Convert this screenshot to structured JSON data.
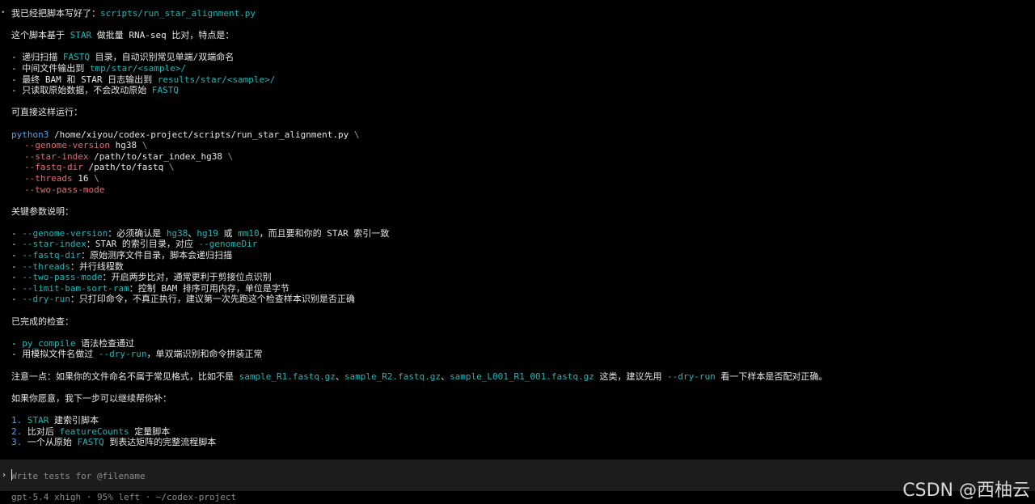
{
  "message": {
    "intro": "我已经把脚本写好了：",
    "script_path": "scripts/run_star_alignment.py",
    "summary_a": "这个脚本基于 ",
    "summary_star": "STAR",
    "summary_b": " 做批量 RNA-seq 比对，特点是：",
    "features": {
      "f1_a": "- 递归扫描 ",
      "f1_code": "FASTQ",
      "f1_b": " 目录，自动识别常见单端/双端命名",
      "f2_a": "- 中间文件输出到 ",
      "f2_code": "tmp/star/<sample>/",
      "f3_a": "- 最终 BAM 和 STAR 日志输出到 ",
      "f3_code": "results/star/<sample>/",
      "f4_a": "- 只读取原始数据，不会改动原始 ",
      "f4_code": "FASTQ"
    },
    "run_heading": "可直接这样运行：",
    "command": {
      "exe": "python3",
      "path": " /home/xiyou/codex-project/scripts/run_star_alignment.py ",
      "cont": "\\",
      "genome_flag": "--genome-version",
      "genome_val": " hg38 ",
      "index_flag": "--star-index",
      "index_val": " /path/to/star_index_hg38 ",
      "fastq_flag": "--fastq-dir",
      "fastq_val": " /path/to/fastq ",
      "threads_flag": "--threads",
      "threads_val": " 16 ",
      "twopass_flag": "--two-pass-mode"
    },
    "params_heading": "关键参数说明：",
    "params": {
      "p1_flag": "--genome-version",
      "p1_a": "：必须确认是 ",
      "p1_c1": "hg38",
      "p1_sep1": "、",
      "p1_c2": "hg19",
      "p1_or": " 或 ",
      "p1_c3": "mm10",
      "p1_b": "，而且要和你的 STAR 索引一致",
      "p2_flag": "--star-index",
      "p2_a": "：STAR 的索引目录，对应 ",
      "p2_code": "--genomeDir",
      "p3_flag": "--fastq-dir",
      "p3_a": "：原始测序文件目录，脚本会递归扫描",
      "p4_flag": "--threads",
      "p4_a": "：并行线程数",
      "p5_flag": "--two-pass-mode",
      "p5_a": "：开启两步比对，通常更利于剪接位点识别",
      "p6_flag": "--limit-bam-sort-ram",
      "p6_a": "：控制 BAM 排序可用内存，单位是字节",
      "p7_flag": "--dry-run",
      "p7_a": "：只打印命令，不真正执行，建议第一次先跑这个检查样本识别是否正确"
    },
    "done_heading": "已完成的检查：",
    "checks": {
      "c1_code": "py_compile",
      "c1_a": " 语法检查通过",
      "c2_a": "- 用模拟文件名做过 ",
      "c2_code": "--dry-run",
      "c2_b": "，单双端识别和命令拼装正常"
    },
    "note": {
      "a": "注意一点：如果你的文件命名不属于常见格式，比如不是 ",
      "c1": "sample_R1.fastq.gz",
      "s1": "、",
      "c2": "sample_R2.fastq.gz",
      "s2": "、",
      "c3": "sample_L001_R1_001.fastq.gz",
      "b": " 这类，建议先用 ",
      "c4": "--dry-run",
      "c": " 看一下样本是否配对正确。"
    },
    "next_heading": "如果你愿意，我下一步可以继续帮你补：",
    "next": {
      "n1_num": "1.",
      "n1_code": "STAR",
      "n1_a": " 建索引脚本",
      "n2_num": "2.",
      "n2_a": " 比对后 ",
      "n2_code": "featureCounts",
      "n2_b": " 定量脚本",
      "n3_num": "3.",
      "n3_a": " 一个从原始 ",
      "n3_code": "FASTQ",
      "n3_b": " 到表达矩阵的完整流程脚本"
    }
  },
  "composer": {
    "caret": "›",
    "placeholder": "Write tests for @filename"
  },
  "status": {
    "text": "gpt-5.4 xhigh · 95% left · ~/codex-project"
  },
  "watermark": "CSDN @西柚云",
  "icons": {
    "bullet": "•",
    "prompt": "›"
  },
  "colors": {
    "background": "#000000",
    "text": "#e6e6e6",
    "code": "#21b5b5",
    "flag": "#e06c75",
    "command": "#5aa2e8",
    "composer_bg": "#1c1c1c"
  }
}
